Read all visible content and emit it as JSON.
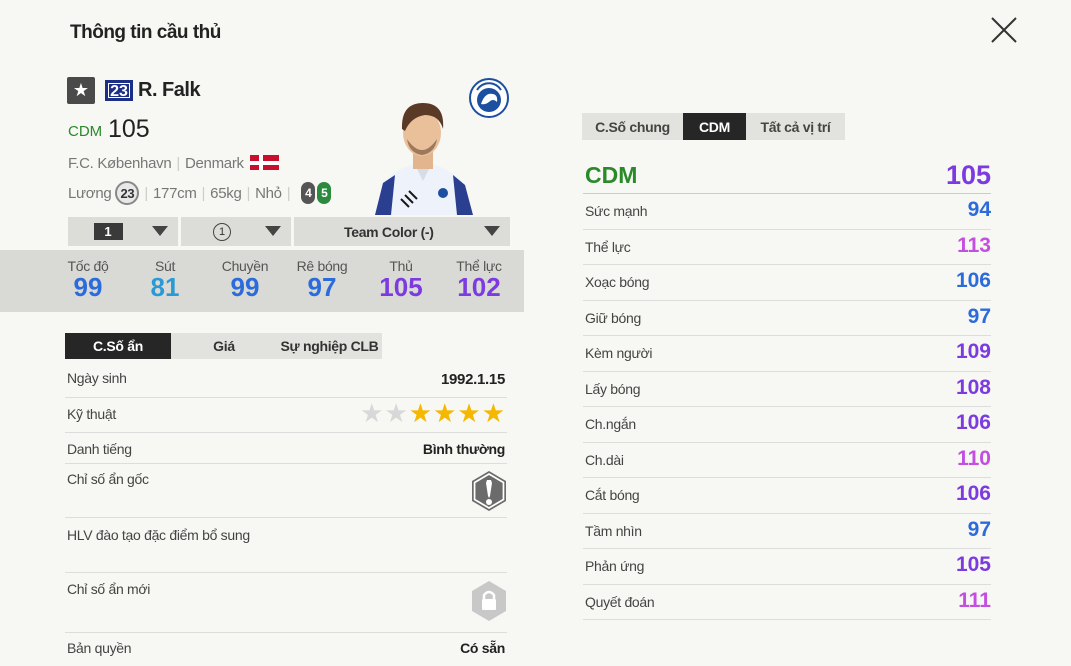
{
  "header": {
    "title": "Thông tin cầu thủ"
  },
  "player": {
    "star": "★",
    "number": "23",
    "name": "R. Falk",
    "position": "CDM",
    "ovr": "105",
    "club": "F.C. København",
    "nation": "Denmark",
    "salary_label": "Lương",
    "salary": "23",
    "height": "177cm",
    "weight": "65kg",
    "body": "Nhỏ",
    "weak_foot": "4",
    "strong_foot": "5"
  },
  "selectors": {
    "level": "1",
    "enhance": "1",
    "team_color": "Team Color (-)"
  },
  "stats": [
    {
      "label": "Tốc độ",
      "value": "99",
      "color": "#2c6bdc"
    },
    {
      "label": "Sút",
      "value": "81",
      "color": "#2a9ad6"
    },
    {
      "label": "Chuyền",
      "value": "99",
      "color": "#2c6bdc"
    },
    {
      "label": "Rê bóng",
      "value": "97",
      "color": "#2c6bdc"
    },
    {
      "label": "Thủ",
      "value": "105",
      "color": "#7b3be0"
    },
    {
      "label": "Thể lực",
      "value": "102",
      "color": "#7b3be0"
    }
  ],
  "left_tabs": [
    "C.Số ẩn",
    "Giá",
    "Sự nghiệp CLB"
  ],
  "info": {
    "dob_label": "Ngày sinh",
    "dob": "1992.1.15",
    "skill_label": "Kỹ thuật",
    "skill_stars": 4,
    "skill_max": 6,
    "rep_label": "Danh tiếng",
    "rep": "Bình thường",
    "hidden_label": "Chỉ số ẩn gốc",
    "coach_label": "HLV đào tạo đặc điểm bổ sung",
    "new_hidden_label": "Chỉ số ẩn mới",
    "copyright_label": "Bản quyền",
    "copyright": "Có sẵn"
  },
  "right_tabs": [
    "C.Số chung",
    "CDM",
    "Tất cả vị trí"
  ],
  "position_header": {
    "label": "CDM",
    "value": "105"
  },
  "attributes": [
    {
      "label": "Sức mạnh",
      "value": "94",
      "color": "#2c6bdc"
    },
    {
      "label": "Thể lực",
      "value": "113",
      "color": "#c34ee0"
    },
    {
      "label": "Xoạc bóng",
      "value": "106",
      "color": "#2c6bdc"
    },
    {
      "label": "Giữ bóng",
      "value": "97",
      "color": "#2c6bdc"
    },
    {
      "label": "Kèm người",
      "value": "109",
      "color": "#7b3be0"
    },
    {
      "label": "Lấy bóng",
      "value": "108",
      "color": "#7b3be0"
    },
    {
      "label": "Ch.ngắn",
      "value": "106",
      "color": "#7b3be0"
    },
    {
      "label": "Ch.dài",
      "value": "110",
      "color": "#c34ee0"
    },
    {
      "label": "Cắt bóng",
      "value": "106",
      "color": "#7b3be0"
    },
    {
      "label": "Tầm nhìn",
      "value": "97",
      "color": "#2c6bdc"
    },
    {
      "label": "Phản ứng",
      "value": "105",
      "color": "#7b3be0"
    },
    {
      "label": "Quyết đoán",
      "value": "111",
      "color": "#c34ee0"
    }
  ]
}
